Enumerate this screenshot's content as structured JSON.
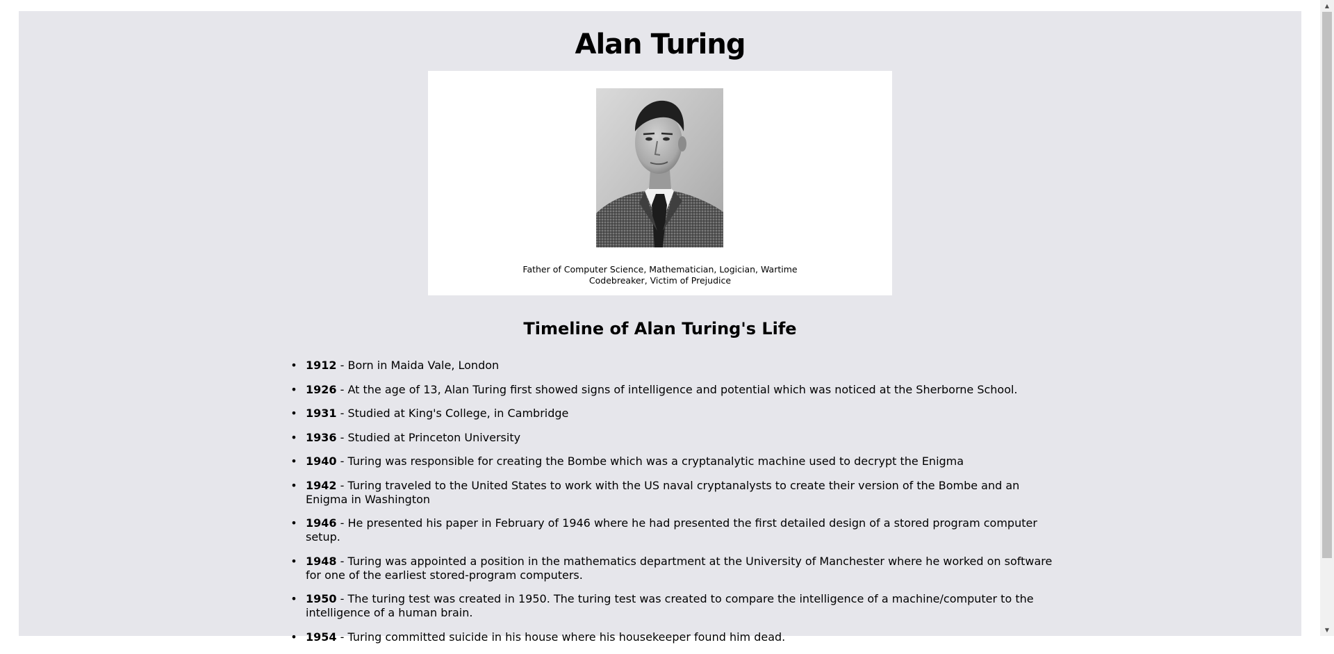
{
  "page": {
    "title": "Alan Turing",
    "image_caption": "Father of Computer Science, Mathematician, Logician, Wartime Codebreaker, Victim of Prejudice",
    "timeline_heading": "Timeline of Alan Turing's Life"
  },
  "timeline": [
    {
      "year": "1912",
      "text": " - Born in Maida Vale, London"
    },
    {
      "year": "1926",
      "text": " - At the age of 13, Alan Turing first showed signs of intelligence and potential which was noticed at the Sherborne School."
    },
    {
      "year": "1931",
      "text": " - Studied at King's College, in Cambridge"
    },
    {
      "year": "1936",
      "text": " - Studied at Princeton University"
    },
    {
      "year": "1940",
      "text": " - Turing was responsible for creating the Bombe which was a cryptanalytic machine used to decrypt the Enigma"
    },
    {
      "year": "1942",
      "text": " - Turing traveled to the United States to work with the US naval cryptanalysts to create their version of the Bombe and an Enigma in Washington"
    },
    {
      "year": "1946",
      "text": " - He presented his paper in February of 1946 where he had presented the first detailed design of a stored program computer setup."
    },
    {
      "year": "1948",
      "text": " - Turing was appointed a position in the mathematics department at the University of Manchester where he worked on software for one of the earliest stored-program computers."
    },
    {
      "year": "1950",
      "text": " - The turing test was created in 1950. The turing test was created to compare the intelligence of a machine/computer to the intelligence of a human brain."
    },
    {
      "year": "1954",
      "text": " - Turing committed suicide in his house where his housekeeper found him dead."
    }
  ],
  "colors": {
    "main_background": "#e6e6eb",
    "card_background": "#ffffff",
    "scrollbar_thumb": "#c1c1c1"
  },
  "icons": {
    "bullet": "•",
    "scroll_up": "▲",
    "scroll_down": "▼"
  }
}
